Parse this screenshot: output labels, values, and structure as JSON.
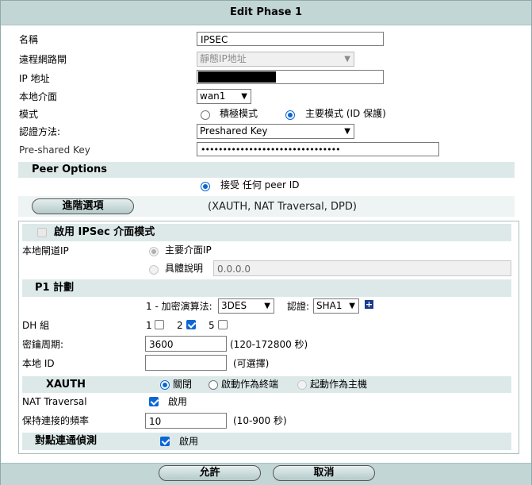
{
  "title": "Edit Phase 1",
  "fields": {
    "name_label": "名稱",
    "name_value": "IPSEC",
    "remote_gw_label": "遠程網路閘",
    "remote_gw_value": "靜態IP地址",
    "ip_label": "IP 地址",
    "local_if_label": "本地介面",
    "local_if_value": "wan1",
    "mode_label": "模式",
    "mode_aggressive": "積極模式",
    "mode_main": "主要模式 (ID 保護)",
    "auth_label": "認證方法:",
    "auth_value": "Preshared Key",
    "psk_label": "Pre-shared Key",
    "psk_value": "••••••••••••••••••••••••••••••••"
  },
  "peer": {
    "header": "Peer Options",
    "accept_any": "接受 任何 peer ID"
  },
  "advanced": {
    "button": "進階選項",
    "summary": "(XAUTH, NAT Traversal, DPD)",
    "enable_ipsec_if": "啟用 IPSec 介面模式",
    "local_gw_label": "本地閘道IP",
    "local_gw_main": "主要介面IP",
    "local_gw_specify": "具體說明",
    "local_gw_ip": "0.0.0.0",
    "p1_header": "P1 計劃",
    "proposal_label": "1 - 加密演算法:",
    "encryption": "3DES",
    "auth_label": "認證:",
    "auth_value": "SHA1",
    "plus_icon": "+",
    "dh_label": "DH 組",
    "dh_groups": [
      "1",
      "2",
      "5"
    ],
    "keylife_label": "密鑰周期:",
    "keylife_value": "3600",
    "keylife_range": "(120-172800 秒)",
    "localid_label": "本地 ID",
    "localid_value": "",
    "localid_hint": "(可選擇)",
    "xauth_header": "XAUTH",
    "xauth_off": "關閉",
    "xauth_client": "啟動作為終端",
    "xauth_server": "起動作為主機",
    "nat_label": "NAT Traversal",
    "nat_enable": "啟用",
    "keepalive_label": "保持連接的頻率",
    "keepalive_value": "10",
    "keepalive_range": "(10-900 秒)",
    "dpd_header": "對點連通偵測",
    "dpd_enable": "啟用"
  },
  "footer": {
    "ok": "允許",
    "cancel": "取消"
  },
  "colors": {
    "header_bg": "#c3d6d6",
    "band_bg": "#dde9e9",
    "accent": "#0b66d6"
  }
}
